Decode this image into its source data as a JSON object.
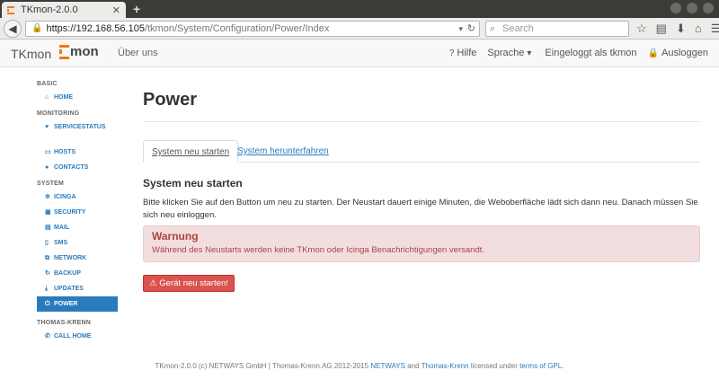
{
  "browser": {
    "tab_title": "TKmon-2.0.0",
    "url_host": "https://192.168.56.105",
    "url_path": "/tkmon/System/Configuration/Power/Index",
    "search_placeholder": "Search"
  },
  "header": {
    "brand": "TKmon",
    "logo_text": "mon",
    "about": "Über uns",
    "help": "Hilfe",
    "language": "Sprache",
    "logged_in": "Eingeloggt als tkmon",
    "logout": "Ausloggen"
  },
  "sidebar": {
    "basic": "BASIC",
    "home": "HOME",
    "monitoring": "MONITORING",
    "servicestatus": "SERVICESTATUS",
    "hosts": "HOSTS",
    "contacts": "CONTACTS",
    "system": "SYSTEM",
    "icinga": "ICINGA",
    "security": "SECURITY",
    "mail": "MAIL",
    "sms": "SMS",
    "network": "NETWORK",
    "backup": "BACKUP",
    "updates": "UPDATES",
    "power": "POWER",
    "thomas_krenn": "THOMAS-KRENN",
    "call_home": "CALL HOME"
  },
  "main": {
    "title": "Power",
    "tab_restart": "System neu starten",
    "tab_shutdown": "System herunterfahren",
    "subheading": "System neu starten",
    "description": "Bitte klicken Sie auf den Button um neu zu starten. Der Neustart dauert einige Minuten, die Weboberfläche lädt sich dann neu. Danach müssen Sie sich neu einloggen.",
    "alert_title": "Warnung",
    "alert_text": "Während des Neustarts werden keine TKmon oder Icinga Benachrichtigungen versandt.",
    "restart_button": "Gerät neu starten!"
  },
  "footer": {
    "prefix": "TKmon-2.0.0 (c) NETWAYS GmbH | Thomas-Krenn.AG 2012-2015 ",
    "netways": "NETWAYS",
    "and": " and ",
    "thomas_krenn": "Thomas-Krenn",
    "licensed": " licensed under ",
    "gpl": "terms of GPL",
    "end": "."
  },
  "colors": {
    "accent": "#2a7bbd",
    "brand_orange": "#e87b18",
    "danger": "#d9534f",
    "alert_bg": "#f2dede"
  }
}
